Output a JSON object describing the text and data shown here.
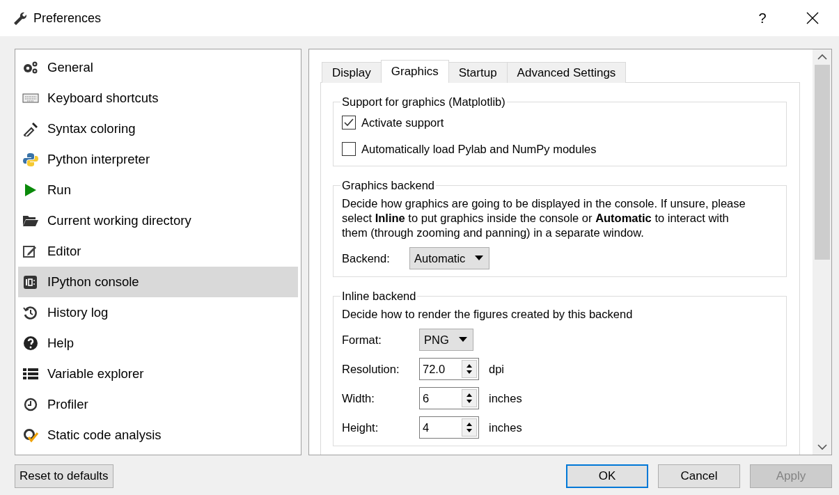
{
  "window": {
    "title": "Preferences",
    "help": "?"
  },
  "sidebar": {
    "items": [
      {
        "label": "General",
        "selected": false
      },
      {
        "label": "Keyboard shortcuts",
        "selected": false
      },
      {
        "label": "Syntax coloring",
        "selected": false
      },
      {
        "label": "Python interpreter",
        "selected": false
      },
      {
        "label": "Run",
        "selected": false
      },
      {
        "label": "Current working directory",
        "selected": false
      },
      {
        "label": "Editor",
        "selected": false
      },
      {
        "label": "IPython console",
        "selected": true
      },
      {
        "label": "History log",
        "selected": false
      },
      {
        "label": "Help",
        "selected": false
      },
      {
        "label": "Variable explorer",
        "selected": false
      },
      {
        "label": "Profiler",
        "selected": false
      },
      {
        "label": "Static code analysis",
        "selected": false
      }
    ]
  },
  "tabs": [
    {
      "label": "Display",
      "selected": false
    },
    {
      "label": "Graphics",
      "selected": true
    },
    {
      "label": "Startup",
      "selected": false
    },
    {
      "label": "Advanced Settings",
      "selected": false
    }
  ],
  "groups": [
    {
      "title": "Support for graphics (Matplotlib)",
      "rows": [
        {
          "kind": "checkbox",
          "label": "Activate support",
          "checked": true
        },
        {
          "kind": "checkbox",
          "label": "Automatically load Pylab and NumPy modules",
          "checked": false
        }
      ]
    },
    {
      "title": "Graphics backend",
      "rows": [
        {
          "kind": "text",
          "text": "Decide how graphics are going to be displayed in the console. If unsure, please select **Inline** to put graphics inside the console or **Automatic** to interact with them (through zooming and panning) in a separate window."
        },
        {
          "kind": "select",
          "label": "Backend:",
          "value": "Automatic"
        }
      ]
    },
    {
      "title": "Inline backend",
      "rows": [
        {
          "kind": "text",
          "text": "Decide how to render the figures created by this backend"
        },
        {
          "kind": "select",
          "label": "Format:",
          "value": "PNG"
        },
        {
          "kind": "spin",
          "label": "Resolution:",
          "value": "72.0",
          "unit": "dpi"
        },
        {
          "kind": "spin",
          "label": "Width:",
          "value": "6",
          "unit": "inches"
        },
        {
          "kind": "spin",
          "label": "Height:",
          "value": "4",
          "unit": "inches"
        }
      ]
    }
  ],
  "buttons": {
    "reset": {
      "label": "Reset to defaults"
    },
    "actions": [
      {
        "label": "OK",
        "default": true,
        "disabled": false
      },
      {
        "label": "Cancel",
        "default": false,
        "disabled": false
      },
      {
        "label": "Apply",
        "default": false,
        "disabled": true
      }
    ]
  }
}
